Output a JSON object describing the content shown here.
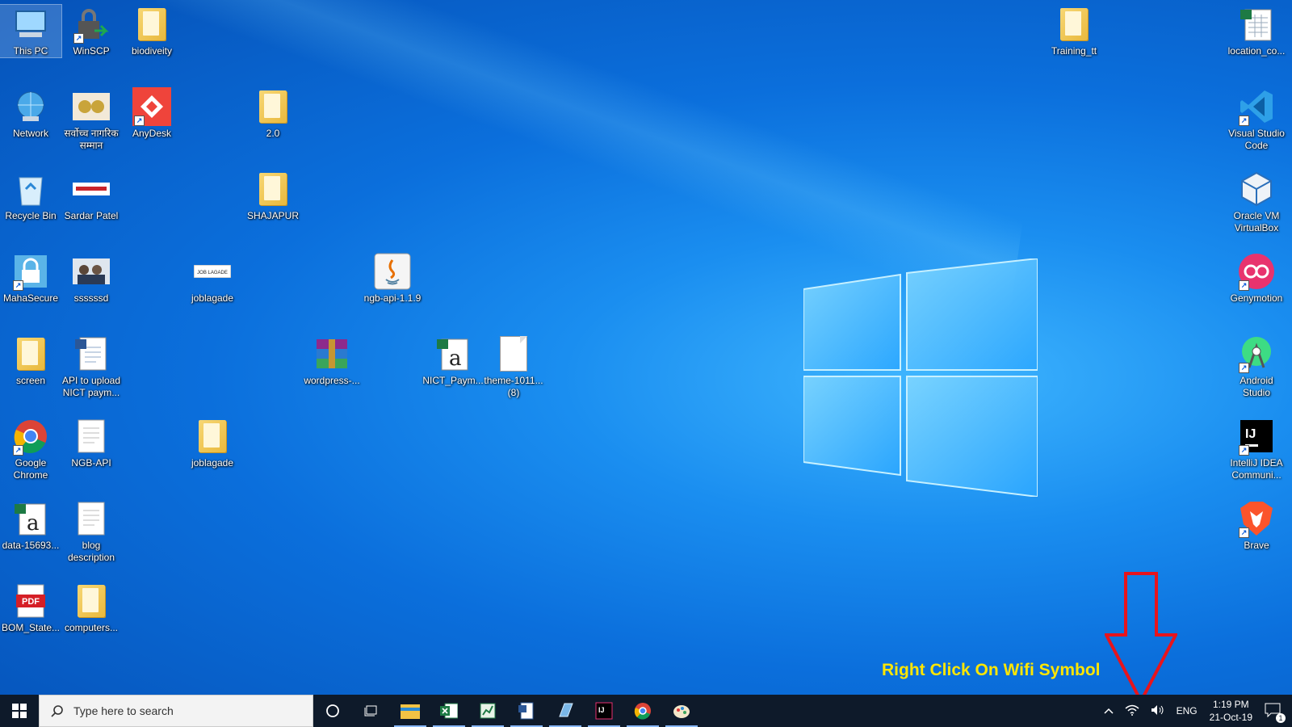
{
  "desktop": {
    "icons": [
      {
        "label": "This PC"
      },
      {
        "label": "WinSCP"
      },
      {
        "label": "biodiveity"
      },
      {
        "label": "Network"
      },
      {
        "label": "सर्वोच्च नागरिक सम्मान"
      },
      {
        "label": "AnyDesk"
      },
      {
        "label": "2.0"
      },
      {
        "label": "Recycle Bin"
      },
      {
        "label": "Sardar Patel"
      },
      {
        "label": "SHAJAPUR"
      },
      {
        "label": "MahaSecure"
      },
      {
        "label": "ssssssd"
      },
      {
        "label": "joblagade"
      },
      {
        "label": "ngb-api-1.1.9"
      },
      {
        "label": "screen"
      },
      {
        "label": "API to upload NICT paym..."
      },
      {
        "label": "wordpress-..."
      },
      {
        "label": "NICT_Paym..."
      },
      {
        "label": "theme-1011... (8)"
      },
      {
        "label": "Google Chrome"
      },
      {
        "label": "NGB-API"
      },
      {
        "label": "joblagade"
      },
      {
        "label": "data-15693..."
      },
      {
        "label": "blog description"
      },
      {
        "label": "BOM_State..."
      },
      {
        "label": "computers..."
      },
      {
        "label": "Training_tt"
      },
      {
        "label": "location_co..."
      },
      {
        "label": "Visual Studio Code"
      },
      {
        "label": "Oracle VM VirtualBox"
      },
      {
        "label": "Genymotion"
      },
      {
        "label": "Android Studio"
      },
      {
        "label": "IntelliJ IDEA Communi..."
      },
      {
        "label": "Brave"
      }
    ],
    "annotation_text": "Right Click On Wifi Symbol",
    "jobbadge_text": "JOB LAGADE",
    "pdf_text": "PDF"
  },
  "taskbar": {
    "search_placeholder": "Type here to search",
    "tray": {
      "language": "ENG",
      "time": "1:19 PM",
      "date": "21-Oct-19",
      "notification_count": "1"
    }
  },
  "colors": {
    "annotation": "#ffe600",
    "arrow": "#e8141c",
    "taskbar": "#0e1a2a"
  }
}
